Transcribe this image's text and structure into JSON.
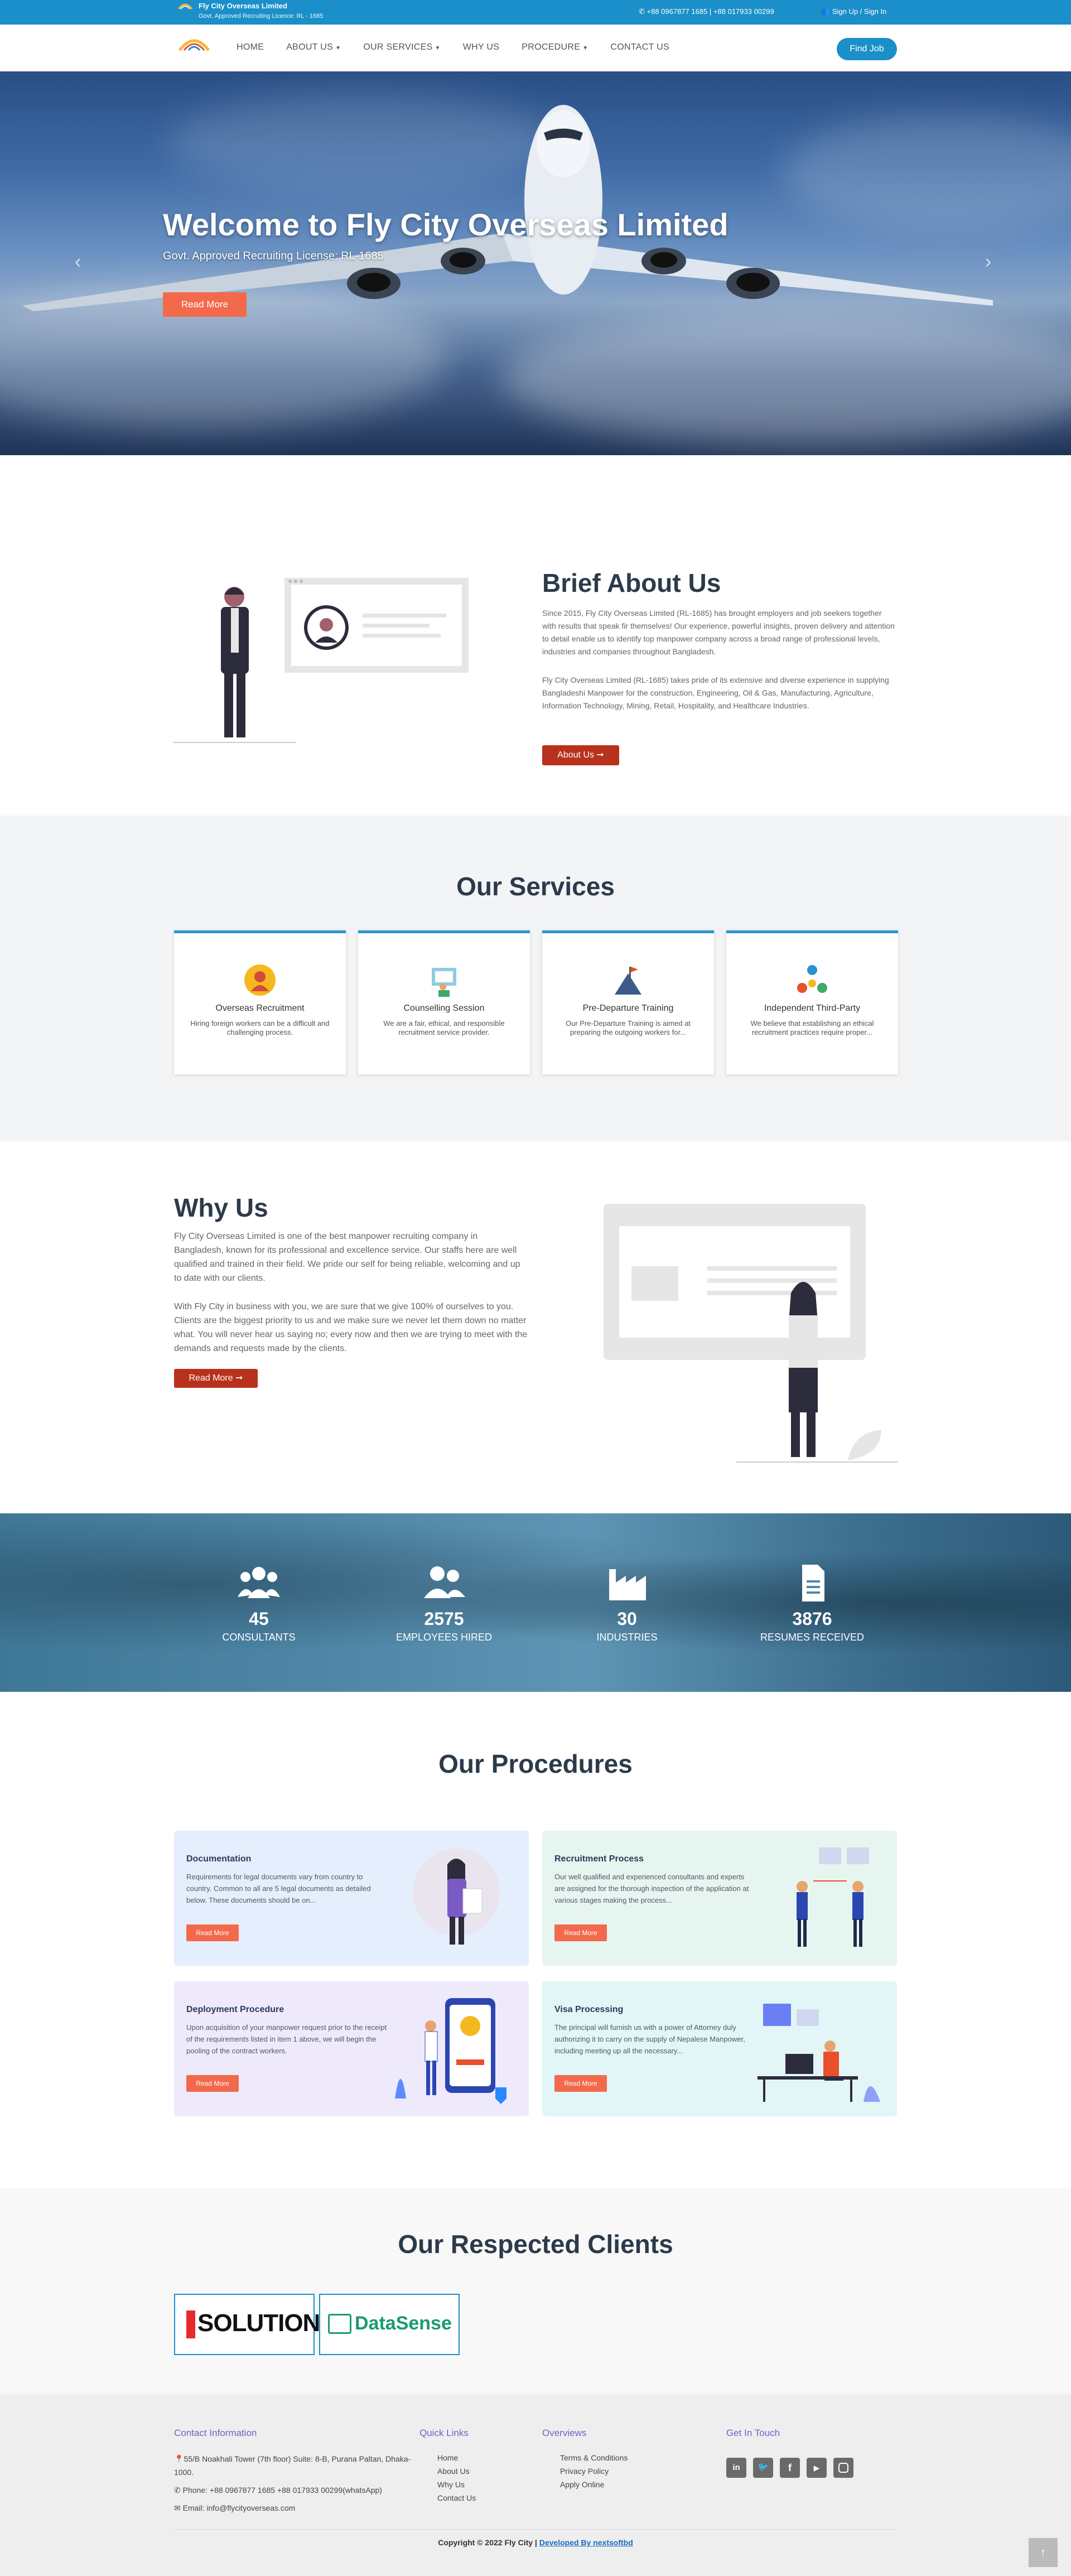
{
  "topbar": {
    "brand": "Fly City Overseas Limited",
    "license": "Govt. Approved Recruiting Licence: RL - 1685",
    "phones": "+88 0967877 1685 | +88 017933 00299",
    "signin": "Sign Up / Sign In"
  },
  "nav": {
    "items": [
      "HOME",
      "ABOUT US",
      "OUR SERVICES",
      "WHY US",
      "PROCEDURE",
      "CONTACT US"
    ],
    "find_job": "Find Job"
  },
  "hero": {
    "title": "Welcome to Fly City Overseas Limited",
    "subtitle": "Govt. Approved Recruiting License: RL-1685",
    "button": "Read More",
    "prev": "‹",
    "next": "›"
  },
  "about": {
    "title": "Brief About Us",
    "p1": "Since 2015, Fly City Overseas Limited (RL-1685) has brought employers and job seekers together with results that speak fir themselves! Our experience, powerful insights, proven delivery and attention to detail enable us to identify top manpower company across a broad range of professional levels, industries and companies throughout Bangladesh.",
    "p2": "Fly City Overseas Limited (RL-1685) takes pride of its extensive and diverse experience in supplying Bangladeshi Manpower for the construction, Engineering, Oil & Gas, Manufacturing, Agriculture, Information Technology, Mining, Retail, Hospitality, and Healthcare Industries.",
    "button": "About Us ➞"
  },
  "services": {
    "title": "Our Services",
    "items": [
      {
        "title": "Overseas Recruitment",
        "desc": "Hiring foreign workers can be a difficult and challenging process."
      },
      {
        "title": "Counselling Session",
        "desc": "We are a fair, ethical, and responsible recruitment service provider."
      },
      {
        "title": "Pre-Departure Training",
        "desc": "Our Pre-Departure Training is aimed at preparing the outgoing workers for..."
      },
      {
        "title": "Independent Third-Party",
        "desc": "We believe that establishing an ethical recruitment practices require proper..."
      }
    ]
  },
  "why": {
    "title": "Why Us",
    "p1": "Fly City Overseas Limited is one of the best manpower recruiting company in Bangladesh, known for its professional and excellence service. Our staffs here are well qualified and trained in their field. We pride our self for being reliable, welcoming and up to date with our clients.",
    "p2": "With Fly City in business with you, we are sure that we give 100% of ourselves to you. Clients are the biggest priority to us and we make sure we never let them down no matter what. You will never hear us saying no; every now and then we are trying to meet with the demands and requests made by the clients.",
    "button": "Read More ➞"
  },
  "stats": [
    {
      "value": "45",
      "label": "CONSULTANTS",
      "icon": "users-icon"
    },
    {
      "value": "2575",
      "label": "EMPLOYEES HIRED",
      "icon": "user-group-icon"
    },
    {
      "value": "30",
      "label": "INDUSTRIES",
      "icon": "industry-icon"
    },
    {
      "value": "3876",
      "label": "RESUMES RECEIVED",
      "icon": "document-icon"
    }
  ],
  "procedures": {
    "title": "Our Procedures",
    "items": [
      {
        "title": "Documentation",
        "desc": "Requirements for legal documents vary from country to country. Common to all are 5 legal documents as detailed below. These documents should be on...",
        "button": "Read More",
        "bg": "#e5eefc"
      },
      {
        "title": "Recruitment Process",
        "desc": "Our well qualified and experienced consultants and experts are assigned for the thorough inspection of the application at various stages making the process...",
        "button": "Read More",
        "bg": "#e6f5ef"
      },
      {
        "title": "Deployment Procedure",
        "desc": "Upon acquisition of your manpower request prior to the receipt of the requirements listed in item 1 above, we will begin the pooling of the contract workers.",
        "button": "Read More",
        "bg": "#efeafb"
      },
      {
        "title": "Visa Processing",
        "desc": "The principal will furnish us with a power of Attorney duly authorizing it to carry on the supply of Nepalese Manpower, including meeting up all the necessary...",
        "button": "Read More",
        "bg": "#e2f6f8"
      }
    ]
  },
  "clients": {
    "title": "Our Respected Clients",
    "logos": [
      "SOLUTION",
      "DataSense"
    ]
  },
  "footer": {
    "contact_title": "Contact Information",
    "address": "55/B Noakhali Tower (7th floor) Suite: 8-B, Purana Paltan, Dhaka-1000.",
    "phone": "Phone: +88 0967877 1685 +88 017933 00299(whatsApp)",
    "email": "Email: info@flycityoverseas.com",
    "quick_title": "Quick Links",
    "quick": [
      "Home",
      "About Us",
      "Why Us",
      "Contact Us"
    ],
    "over_title": "Overviews",
    "over": [
      "Terms & Conditions",
      "Privacy Policy",
      "Apply Online"
    ],
    "touch_title": "Get In Touch",
    "social": [
      "linkedin-icon",
      "twitter-icon",
      "facebook-icon",
      "youtube-icon",
      "instagram-icon"
    ],
    "copyright": "Copyright © 2022 Fly City | ",
    "dev": "Developed By nextsoftbd"
  },
  "colors": {
    "primary": "#1a8fc9",
    "accent": "#f26a4b",
    "dark_red": "#b8311d",
    "heading": "#2c3a4a"
  }
}
